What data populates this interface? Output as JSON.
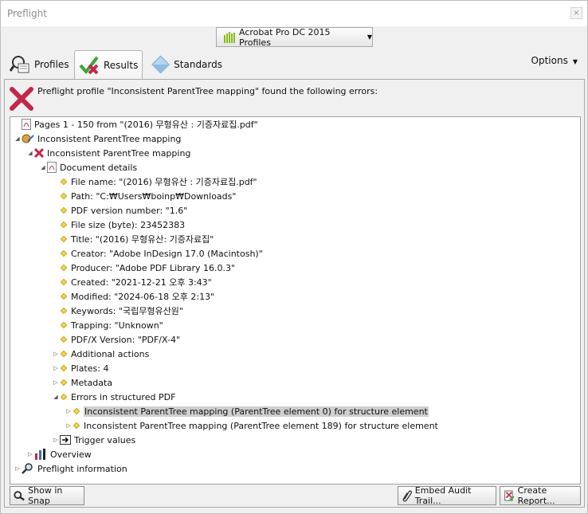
{
  "window": {
    "title": "Preflight",
    "close_glyph": "×"
  },
  "profile_selector": {
    "label": "Acrobat Pro DC 2015 Profiles"
  },
  "tabs": [
    {
      "label": "Profiles",
      "icon": "profiles-icon"
    },
    {
      "label": "Results",
      "icon": "results-icon",
      "active": true
    },
    {
      "label": "Standards",
      "icon": "standards-icon"
    }
  ],
  "options_label": "Options",
  "message": "Preflight profile \"Inconsistent ParentTree mapping\" found the following errors:",
  "tree": {
    "root": "Pages 1 - 150 from \"(2016) 무형유산 : 기증자료집.pdf\"",
    "profile": "Inconsistent ParentTree mapping",
    "check": "Inconsistent ParentTree mapping",
    "doc_details": "Document details",
    "details": [
      "File name: \"(2016) 무형유산 : 기증자료집.pdf\"",
      "Path: \"C:₩Users₩boinp₩Downloads\"",
      "PDF version number: \"1.6\"",
      "File size (byte): 23452383",
      "Title: \"(2016) 무형유산: 기증자료집\"",
      "Creator: \"Adobe InDesign 17.0 (Macintosh)\"",
      "Producer: \"Adobe PDF Library 16.0.3\"",
      "Created: \"2021-12-21 오후 3:43\"",
      "Modified: \"2024-06-18 오후 2:13\"",
      "Keywords: \"국립무형유산원\"",
      "Trapping: \"Unknown\"",
      "PDF/X Version: \"PDF/X-4\""
    ],
    "additional_actions": "Additional actions",
    "plates": "Plates: 4",
    "metadata": "Metadata",
    "errors_structured": "Errors in structured PDF",
    "error_items": [
      "Inconsistent ParentTree mapping (ParentTree element 0) for structure element",
      "Inconsistent ParentTree mapping (ParentTree element 189) for structure element"
    ],
    "trigger_values": "Trigger values",
    "overview": "Overview",
    "preflight_info": "Preflight information"
  },
  "buttons": {
    "show_in_snap": "Show in Snap",
    "embed_audit": "Embed Audit Trail...",
    "create_report": "Create Report..."
  },
  "colors": {
    "error_red": "#c4264a",
    "selection": "#cfcfcf",
    "accent_green": "#8cbc1c"
  }
}
